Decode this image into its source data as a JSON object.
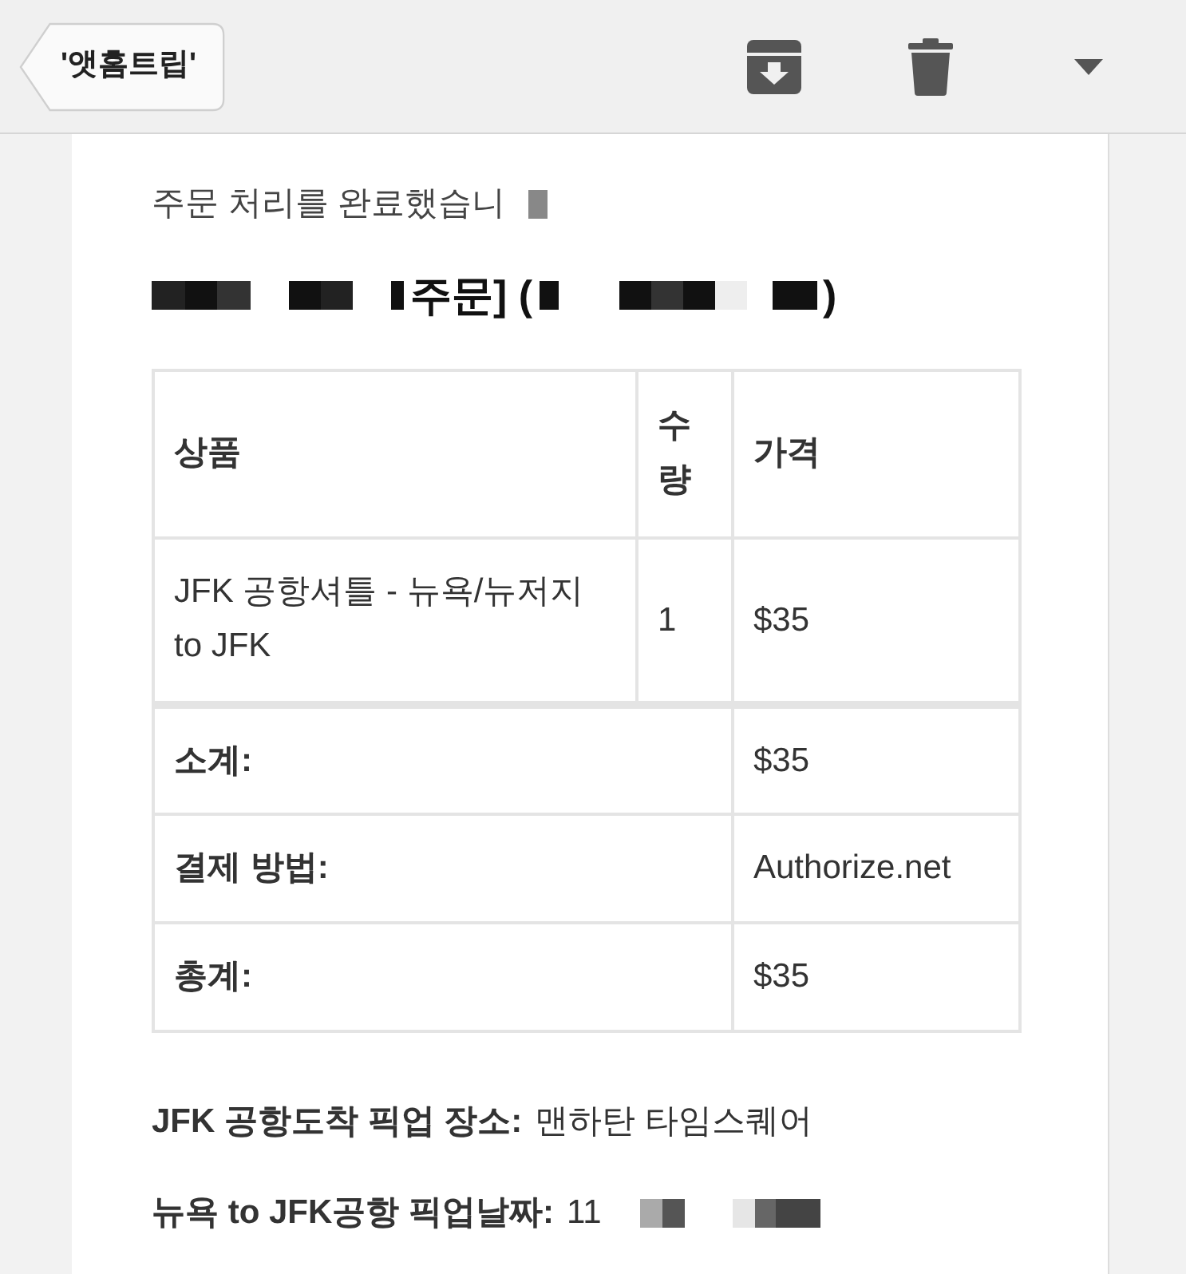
{
  "toolbar": {
    "back_label": "'앳홈트립'"
  },
  "email": {
    "intro": "주문 처리를 완료했습니",
    "heading_middle": "주문] (",
    "heading_end": ")",
    "table": {
      "columns": [
        "상품",
        "수량",
        "가격"
      ],
      "items": [
        {
          "product": "JFK 공항셔틀 - 뉴욕/뉴저지 to JFK",
          "quantity": "1",
          "price": "$35"
        }
      ],
      "totals": [
        {
          "label": "소계:",
          "value": "$35"
        },
        {
          "label": "결제 방법:",
          "value": "Authorize.net"
        },
        {
          "label": "총계:",
          "value": "$35"
        }
      ]
    },
    "details": [
      {
        "label": "JFK 공항도착 픽업 장소:",
        "value": "맨하탄 타임스퀘어"
      },
      {
        "label": "뉴욕 to JFK공항 픽업날짜:",
        "value": "11"
      }
    ]
  }
}
